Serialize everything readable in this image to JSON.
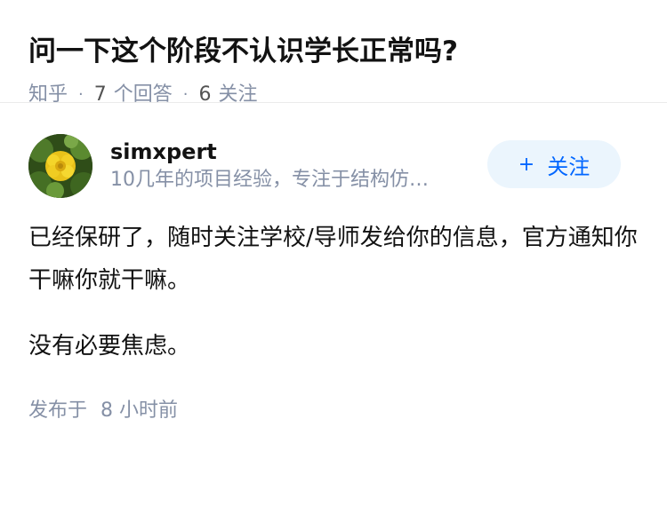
{
  "question": {
    "title": "问一下这个阶段不认识学长正常吗?",
    "source": "知乎",
    "answers_count": "7",
    "answers_label": "个回答",
    "followers_count": "6",
    "followers_label": "关注"
  },
  "answer": {
    "author": {
      "name": "simxpert",
      "headline": "10几年的项目经验，专注于结构仿…",
      "avatar_icon": "flower-avatar"
    },
    "follow_button": {
      "icon": "+",
      "label": "关注"
    },
    "paragraphs": [
      "已经保研了，随时关注学校/导师发给你的信息，官方通知你干嘛你就干嘛。",
      "没有必要焦虑。"
    ],
    "time_label": "发布于",
    "time_value": "8 小时前"
  },
  "colors": {
    "accent": "#0066ff",
    "button_bg": "#ebf5fd",
    "meta_text": "#8590a6"
  }
}
